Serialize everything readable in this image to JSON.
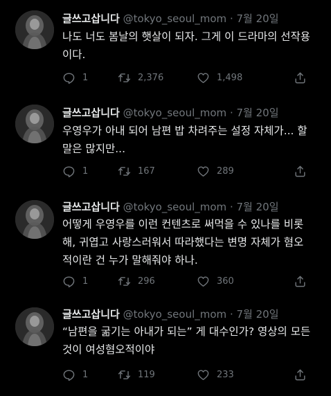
{
  "tweets": [
    {
      "name": "글쓰고삽니다",
      "handle": "@tokyo_seoul_mom",
      "sep": "·",
      "date": "7월 20일",
      "text": "나도 너도 봄날의 햇살이 되자. 그게 이 드라마의 선작용\n이다.",
      "replies": "1",
      "retweets": "2,376",
      "likes": "1,498"
    },
    {
      "name": "글쓰고삽니다",
      "handle": "@tokyo_seoul_mom",
      "sep": "·",
      "date": "7월 20일",
      "text": "우영우가 아내 되어 남편 밥 차려주는 설정 자체가... 할\n말은 많지만...",
      "replies": "1",
      "retweets": "167",
      "likes": "289"
    },
    {
      "name": "글쓰고삽니다",
      "handle": "@tokyo_seoul_mom",
      "sep": "·",
      "date": "7월 20일",
      "text": "어떻게 우영우를 이런 컨텐츠로 써먹을 수 있나를 비롯\n해, 귀엽고 사랑스러워서 따라했다는 변명 자체가 혐오\n적이란 건 누가 말해줘야 하나.",
      "replies": "1",
      "retweets": "296",
      "likes": "360"
    },
    {
      "name": "글쓰고삽니다",
      "handle": "@tokyo_seoul_mom",
      "sep": "·",
      "date": "7월 20일",
      "text": "“남편을 굶기는 아내가 되는” 게 대수인가? 영상의 모든\n것이 여성혐오적이야",
      "replies": "1",
      "retweets": "119",
      "likes": "233"
    }
  ],
  "icons": {
    "reply": "reply-icon",
    "retweet": "retweet-icon",
    "like": "like-icon",
    "share": "share-icon"
  },
  "colors": {
    "background": "#000000",
    "text": "#e7e9ea",
    "muted": "#71767b"
  }
}
